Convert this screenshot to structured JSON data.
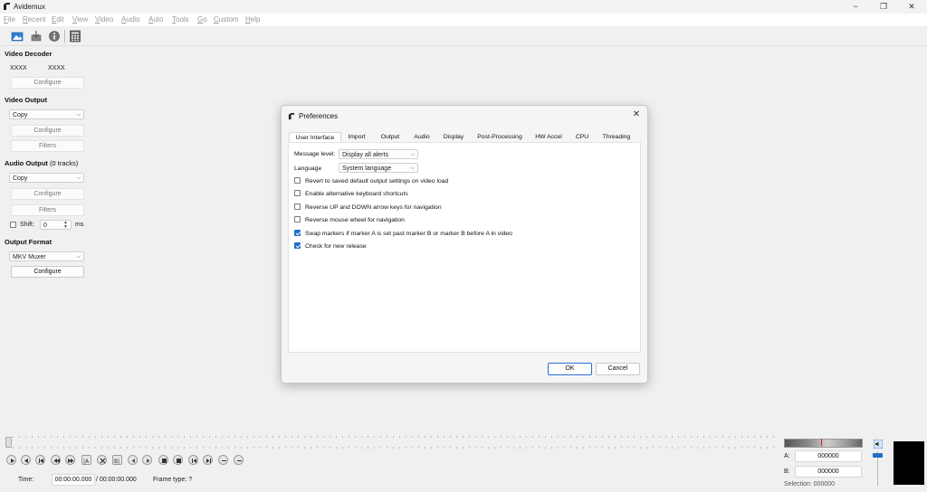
{
  "window": {
    "title": "Avidemux",
    "minimize": "−",
    "maximize": "❐",
    "close": "✕"
  },
  "menu": {
    "items": [
      {
        "first": "F",
        "rest": "ile"
      },
      {
        "first": "R",
        "rest": "ecent"
      },
      {
        "first": "E",
        "rest": "dit"
      },
      {
        "first": "V",
        "rest": "iew"
      },
      {
        "first": "V",
        "rest": "ideo"
      },
      {
        "first": "A",
        "rest": "udio"
      },
      {
        "first": "A",
        "rest": "uto"
      },
      {
        "first": "T",
        "rest": "ools"
      },
      {
        "first": "G",
        "rest": "o"
      },
      {
        "first": "C",
        "rest": "ustom"
      },
      {
        "first": "H",
        "rest": "elp"
      }
    ]
  },
  "toolbar": {
    "icons": [
      "open-video-icon",
      "save-video-icon",
      "video-info-icon",
      "calculator-icon"
    ]
  },
  "left": {
    "video_decoder": {
      "heading": "Video Decoder",
      "label_a": "XXXX",
      "label_b": "XXXX",
      "configure": "Configure"
    },
    "video_output": {
      "heading": "Video Output",
      "codec": "Copy",
      "configure": "Configure",
      "filters": "Filters"
    },
    "audio_output": {
      "heading": "Audio Output",
      "tracks": "(0 tracks)",
      "codec": "Copy",
      "configure": "Configure",
      "filters": "Filters",
      "shift_label": "Shift:",
      "shift_value": "0",
      "shift_unit": "ms"
    },
    "output_format": {
      "heading": "Output Format",
      "muxer": "MKV Muxer",
      "configure": "Configure"
    }
  },
  "dialog": {
    "title": "Preferences",
    "tabs": [
      "User Interface",
      "Import",
      "Output",
      "Audio",
      "Display",
      "Post-Processing",
      "HW Accel",
      "CPU",
      "Threading"
    ],
    "active_tab": "User Interface",
    "message_level_label": "Message level:",
    "message_level_value": "Display all alerts",
    "language_label": "Language",
    "language_value": "System language",
    "options": [
      {
        "label": "Revert to saved default output settings on video load",
        "checked": false
      },
      {
        "label": "Enable alternative keyboard shortcuts",
        "checked": false
      },
      {
        "label": "Reverse UP and DOWN arrow keys for navigation",
        "checked": false
      },
      {
        "label": "Reverse mouse wheel for navigation",
        "checked": false
      },
      {
        "label": "Swap markers if marker A is set past marker B or marker B before A in video",
        "checked": true
      },
      {
        "label": "Check for new release",
        "checked": true
      }
    ],
    "ok": "OK",
    "cancel": "Cancel"
  },
  "bottom": {
    "time_label": "Time:",
    "current_time": "00:00:00.000",
    "total_time": "/ 00:00:00.000",
    "frame_type": "Frame type:  ?",
    "marker_a_label": "A:",
    "marker_a_value": "000000",
    "marker_b_label": "B:",
    "marker_b_value": "000000",
    "selection": "Selection: 000000"
  },
  "colors": {
    "accent": "#1f6fc8",
    "preview_bg": "#000000"
  }
}
